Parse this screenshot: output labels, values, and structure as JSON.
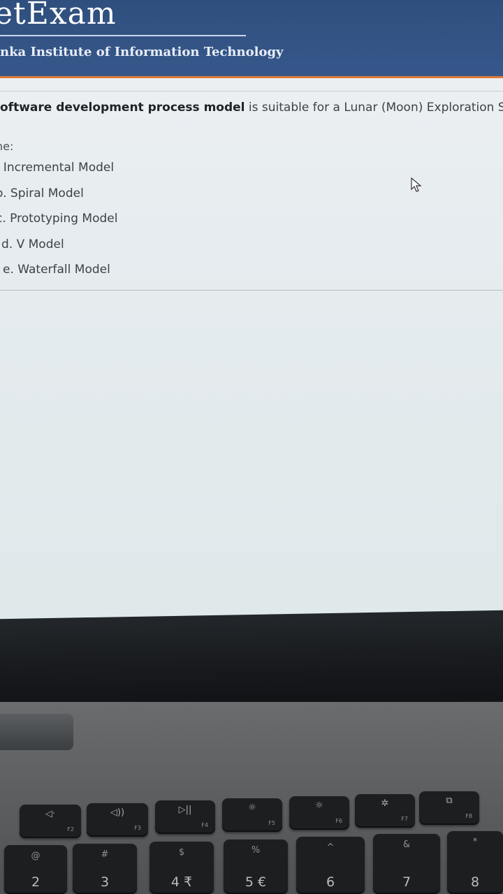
{
  "header": {
    "brand": "etExam",
    "institute": "nka Institute of Information Technology"
  },
  "question": {
    "bold_part": "oftware development process model",
    "rest": " is suitable for a Lunar (Moon) Exploration System"
  },
  "select_label": "ne:",
  "options": [
    {
      "label": ". Incremental Model"
    },
    {
      "label": "o. Spiral Model"
    },
    {
      "label": "c. Prototyping Model"
    },
    {
      "label": "d. V Model"
    },
    {
      "label": "e. Waterfall Model"
    }
  ],
  "keyboard": {
    "fn_row": [
      {
        "icon": "volume-mute-icon",
        "glyph": "◁·",
        "sub": "F2"
      },
      {
        "icon": "volume-up-icon",
        "glyph": "◁))",
        "sub": "F3"
      },
      {
        "icon": "play-pause-icon",
        "glyph": "▷||",
        "sub": "F4"
      },
      {
        "icon": "keyboard-light-icon",
        "glyph": "☼",
        "sub": "F5"
      },
      {
        "icon": "brightness-down-icon",
        "glyph": "☼",
        "sub": "F6"
      },
      {
        "icon": "brightness-up-icon",
        "glyph": "✲",
        "sub": "F7"
      },
      {
        "icon": "display-switch-icon",
        "glyph": "⧉",
        "sub": "F8"
      }
    ],
    "num_row": [
      {
        "top": "@",
        "main": "2"
      },
      {
        "top": "#",
        "main": "3"
      },
      {
        "top": "$",
        "main": "4 ₹"
      },
      {
        "top": "%",
        "main": "5 €"
      },
      {
        "top": "^",
        "main": "6"
      },
      {
        "top": "&",
        "main": "7"
      },
      {
        "top": "*",
        "main": "8"
      }
    ]
  }
}
